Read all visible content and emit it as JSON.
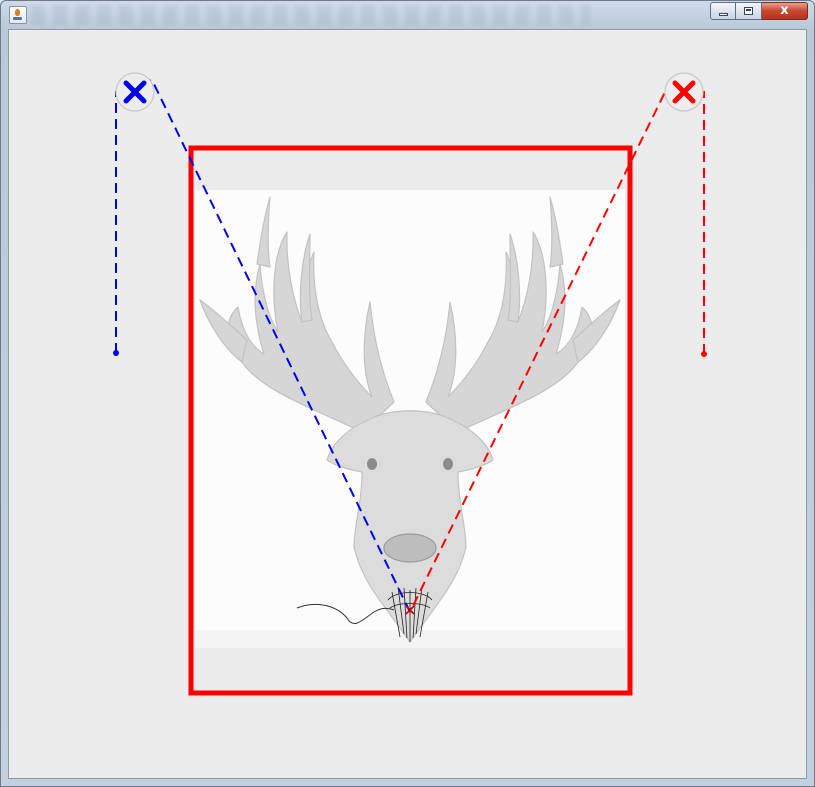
{
  "window": {
    "title": "",
    "controls": {
      "minimize_icon": "minimize-icon",
      "maximize_icon": "maximize-icon",
      "close_icon": "close-icon",
      "close_glyph": "x"
    }
  },
  "canvas": {
    "background": "#ececec",
    "frame_color": "#ff0000",
    "image": {
      "subject": "deer-head-sketch",
      "tint": "#c8c8c8"
    },
    "left_anchor": {
      "icon": "x-icon",
      "color": "#0000ee"
    },
    "right_anchor": {
      "icon": "x-icon",
      "color": "#ff0000"
    },
    "left_line_color": "#0000ee",
    "right_line_color": "#ff0000"
  }
}
